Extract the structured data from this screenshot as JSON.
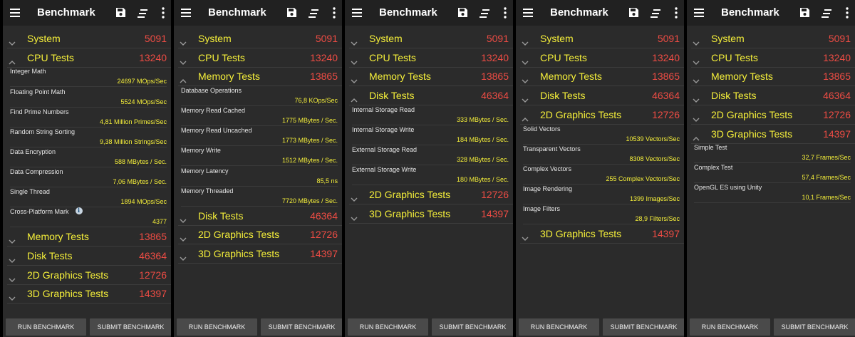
{
  "app": {
    "title": "Benchmark",
    "icons": {
      "menu": "hamburger-menu-icon",
      "save": "save-icon",
      "sort": "sort-icon",
      "more": "more-vert-icon"
    }
  },
  "colors": {
    "category": "#f5ef3a",
    "score": "#ee4c44",
    "value": "#f5ef3a",
    "label": "#e6e6e6",
    "appbar": "#212121",
    "background": "#2b2b2b",
    "button": "#4a4a4a"
  },
  "buttons": {
    "run": "RUN BENCHMARK",
    "submit": "SUBMIT BENCHMARK"
  },
  "panels": [
    {
      "expanded": "CPU Tests",
      "rows": [
        {
          "type": "category",
          "name": "System",
          "score": "5091",
          "expanded": false
        },
        {
          "type": "category",
          "name": "CPU Tests",
          "score": "13240",
          "expanded": true
        },
        {
          "type": "sub",
          "name": "Integer Math",
          "value": "24697 MOps/Sec"
        },
        {
          "type": "sub",
          "name": "Floating Point Math",
          "value": "5524 MOps/Sec"
        },
        {
          "type": "sub",
          "name": "Find Prime Numbers",
          "value": "4,81 Million Primes/Sec"
        },
        {
          "type": "sub",
          "name": "Random String Sorting",
          "value": "9,38 Million Strings/Sec"
        },
        {
          "type": "sub",
          "name": "Data Encryption",
          "value": "588 MBytes / Sec."
        },
        {
          "type": "sub",
          "name": "Data Compression",
          "value": "7,06 MBytes / Sec."
        },
        {
          "type": "sub",
          "name": "Single Thread",
          "value": "1894 MOps/Sec"
        },
        {
          "type": "sub",
          "name": "Cross-Platform Mark",
          "value": "4377",
          "info": true
        },
        {
          "type": "category",
          "name": "Memory Tests",
          "score": "13865",
          "expanded": false
        },
        {
          "type": "category",
          "name": "Disk Tests",
          "score": "46364",
          "expanded": false
        },
        {
          "type": "category",
          "name": "2D Graphics Tests",
          "score": "12726",
          "expanded": false
        },
        {
          "type": "category",
          "name": "3D Graphics Tests",
          "score": "14397",
          "expanded": false
        }
      ]
    },
    {
      "expanded": "Memory Tests",
      "rows": [
        {
          "type": "category",
          "name": "System",
          "score": "5091",
          "expanded": false
        },
        {
          "type": "category",
          "name": "CPU Tests",
          "score": "13240",
          "expanded": false
        },
        {
          "type": "category",
          "name": "Memory Tests",
          "score": "13865",
          "expanded": true
        },
        {
          "type": "sub",
          "name": "Database Operations",
          "value": "76,8 KOps/Sec"
        },
        {
          "type": "sub",
          "name": "Memory Read Cached",
          "value": "1775 MBytes / Sec."
        },
        {
          "type": "sub",
          "name": "Memory Read Uncached",
          "value": "1773 MBytes / Sec."
        },
        {
          "type": "sub",
          "name": "Memory Write",
          "value": "1512 MBytes / Sec."
        },
        {
          "type": "sub",
          "name": "Memory Latency",
          "value": "85,5 ns"
        },
        {
          "type": "sub",
          "name": "Memory Threaded",
          "value": "7720 MBytes / Sec."
        },
        {
          "type": "category",
          "name": "Disk Tests",
          "score": "46364",
          "expanded": false
        },
        {
          "type": "category",
          "name": "2D Graphics Tests",
          "score": "12726",
          "expanded": false
        },
        {
          "type": "category",
          "name": "3D Graphics Tests",
          "score": "14397",
          "expanded": false
        }
      ]
    },
    {
      "expanded": "Disk Tests",
      "rows": [
        {
          "type": "category",
          "name": "System",
          "score": "5091",
          "expanded": false
        },
        {
          "type": "category",
          "name": "CPU Tests",
          "score": "13240",
          "expanded": false
        },
        {
          "type": "category",
          "name": "Memory Tests",
          "score": "13865",
          "expanded": false
        },
        {
          "type": "category",
          "name": "Disk Tests",
          "score": "46364",
          "expanded": true
        },
        {
          "type": "sub",
          "name": "Internal Storage Read",
          "value": "333 MBytes / Sec."
        },
        {
          "type": "sub",
          "name": "Internal Storage Write",
          "value": "184 MBytes / Sec."
        },
        {
          "type": "sub",
          "name": "External Storage Read",
          "value": "328 MBytes / Sec."
        },
        {
          "type": "sub",
          "name": "External Storage Write",
          "value": "180 MBytes / Sec."
        },
        {
          "type": "category",
          "name": "2D Graphics Tests",
          "score": "12726",
          "expanded": false
        },
        {
          "type": "category",
          "name": "3D Graphics Tests",
          "score": "14397",
          "expanded": false
        }
      ]
    },
    {
      "expanded": "2D Graphics Tests",
      "rows": [
        {
          "type": "category",
          "name": "System",
          "score": "5091",
          "expanded": false
        },
        {
          "type": "category",
          "name": "CPU Tests",
          "score": "13240",
          "expanded": false
        },
        {
          "type": "category",
          "name": "Memory Tests",
          "score": "13865",
          "expanded": false
        },
        {
          "type": "category",
          "name": "Disk Tests",
          "score": "46364",
          "expanded": false
        },
        {
          "type": "category",
          "name": "2D Graphics Tests",
          "score": "12726",
          "expanded": true
        },
        {
          "type": "sub",
          "name": "Solid Vectors",
          "value": "10539 Vectors/Sec"
        },
        {
          "type": "sub",
          "name": "Transparent Vectors",
          "value": "8308 Vectors/Sec"
        },
        {
          "type": "sub",
          "name": "Complex Vectors",
          "value": "255 Complex Vectors/Sec"
        },
        {
          "type": "sub",
          "name": "Image Rendering",
          "value": "1399 Images/Sec"
        },
        {
          "type": "sub",
          "name": "Image Filters",
          "value": "28,9 Filters/Sec"
        },
        {
          "type": "category",
          "name": "3D Graphics Tests",
          "score": "14397",
          "expanded": false
        }
      ]
    },
    {
      "expanded": "3D Graphics Tests",
      "rows": [
        {
          "type": "category",
          "name": "System",
          "score": "5091",
          "expanded": false
        },
        {
          "type": "category",
          "name": "CPU Tests",
          "score": "13240",
          "expanded": false
        },
        {
          "type": "category",
          "name": "Memory Tests",
          "score": "13865",
          "expanded": false
        },
        {
          "type": "category",
          "name": "Disk Tests",
          "score": "46364",
          "expanded": false
        },
        {
          "type": "category",
          "name": "2D Graphics Tests",
          "score": "12726",
          "expanded": false
        },
        {
          "type": "category",
          "name": "3D Graphics Tests",
          "score": "14397",
          "expanded": true
        },
        {
          "type": "sub",
          "name": "Simple Test",
          "value": "32,7 Frames/Sec"
        },
        {
          "type": "sub",
          "name": "Complex Test",
          "value": "57,4 Frames/Sec"
        },
        {
          "type": "sub",
          "name": "OpenGL ES using Unity",
          "value": "10,1 Frames/Sec"
        }
      ]
    }
  ]
}
